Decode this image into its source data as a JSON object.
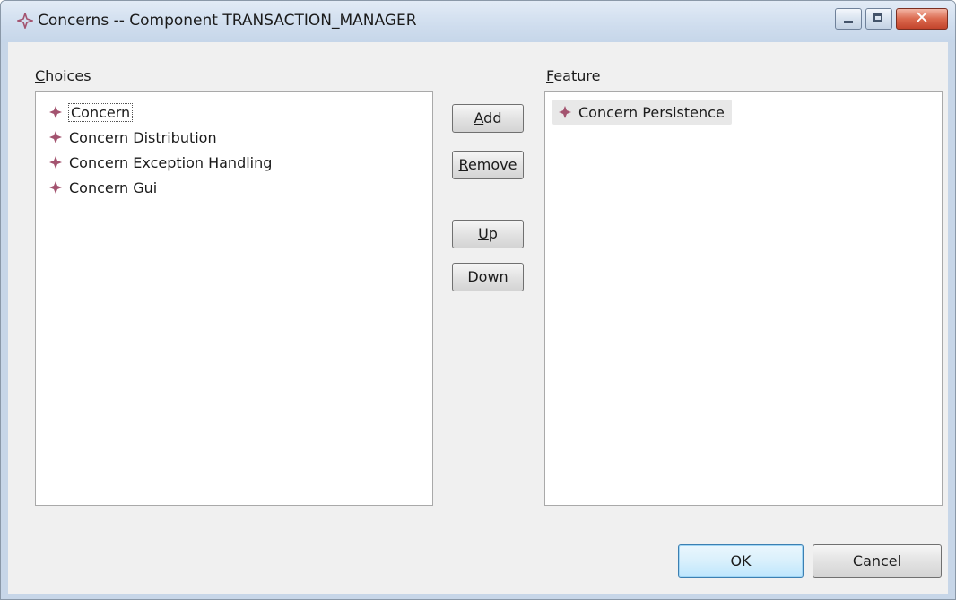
{
  "window": {
    "title": "Concerns -- Component TRANSACTION_MANAGER",
    "icon": "diamond-icon"
  },
  "choices": {
    "label_mnemonic": "C",
    "label_rest": "hoices",
    "items": [
      {
        "label": "Concern",
        "icon": "concern-diamond-icon",
        "focused": true
      },
      {
        "label": "Concern Distribution",
        "icon": "concern-diamond-icon"
      },
      {
        "label": "Concern Exception Handling",
        "icon": "concern-diamond-icon"
      },
      {
        "label": "Concern Gui",
        "icon": "concern-diamond-icon"
      }
    ]
  },
  "feature": {
    "label_mnemonic": "F",
    "label_rest": "eature",
    "items": [
      {
        "label": "Concern Persistence",
        "icon": "concern-diamond-icon",
        "selected": true
      }
    ]
  },
  "buttons": {
    "add": {
      "mnemonic": "A",
      "rest": "dd"
    },
    "remove": {
      "mnemonic": "R",
      "rest": "emove"
    },
    "up": {
      "mnemonic": "U",
      "rest": "p"
    },
    "down": {
      "mnemonic": "D",
      "rest": "own"
    },
    "ok": "OK",
    "cancel": "Cancel"
  },
  "colors": {
    "diamond": "#a3536f",
    "title_bar": "#cfddee",
    "close_button": "#d0553a"
  }
}
